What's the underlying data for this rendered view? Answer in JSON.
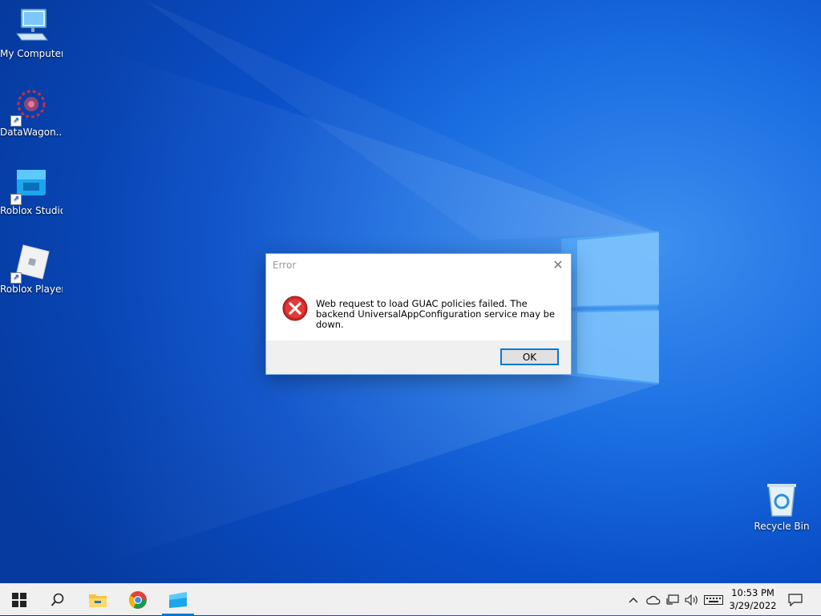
{
  "desktop": {
    "icons": [
      {
        "label": "My Computer",
        "icon": "computer-icon"
      },
      {
        "label": "DataWagon...",
        "icon": "datawagon-icon"
      },
      {
        "label": "Roblox Studio",
        "icon": "roblox-studio-icon"
      },
      {
        "label": "Roblox Player",
        "icon": "roblox-player-icon"
      },
      {
        "label": "Recycle Bin",
        "icon": "recycle-bin-icon"
      }
    ]
  },
  "dialog": {
    "title": "Error",
    "close_glyph": "✕",
    "icon": "error-icon",
    "message": "Web request to load GUAC policies failed. The backend UniversalAppConfiguration service may be down.",
    "ok_label": "OK"
  },
  "taskbar": {
    "buttons": [
      {
        "name": "start",
        "icon": "windows-logo-icon"
      },
      {
        "name": "search",
        "icon": "search-icon"
      },
      {
        "name": "file-explorer",
        "icon": "folder-icon"
      },
      {
        "name": "chrome",
        "icon": "chrome-icon"
      },
      {
        "name": "roblox-studio",
        "icon": "roblox-studio-icon",
        "active": true
      }
    ],
    "tray": [
      "chevron-up-icon",
      "cloud-icon",
      "network-icon",
      "volume-icon",
      "keyboard-icon",
      "notifications-icon"
    ],
    "time": "10:53 PM",
    "date": "3/29/2022"
  },
  "colors": {
    "accent": "#0078d7",
    "error_red": "#d32f2f",
    "desktop_blue": "#0a4fc8"
  }
}
